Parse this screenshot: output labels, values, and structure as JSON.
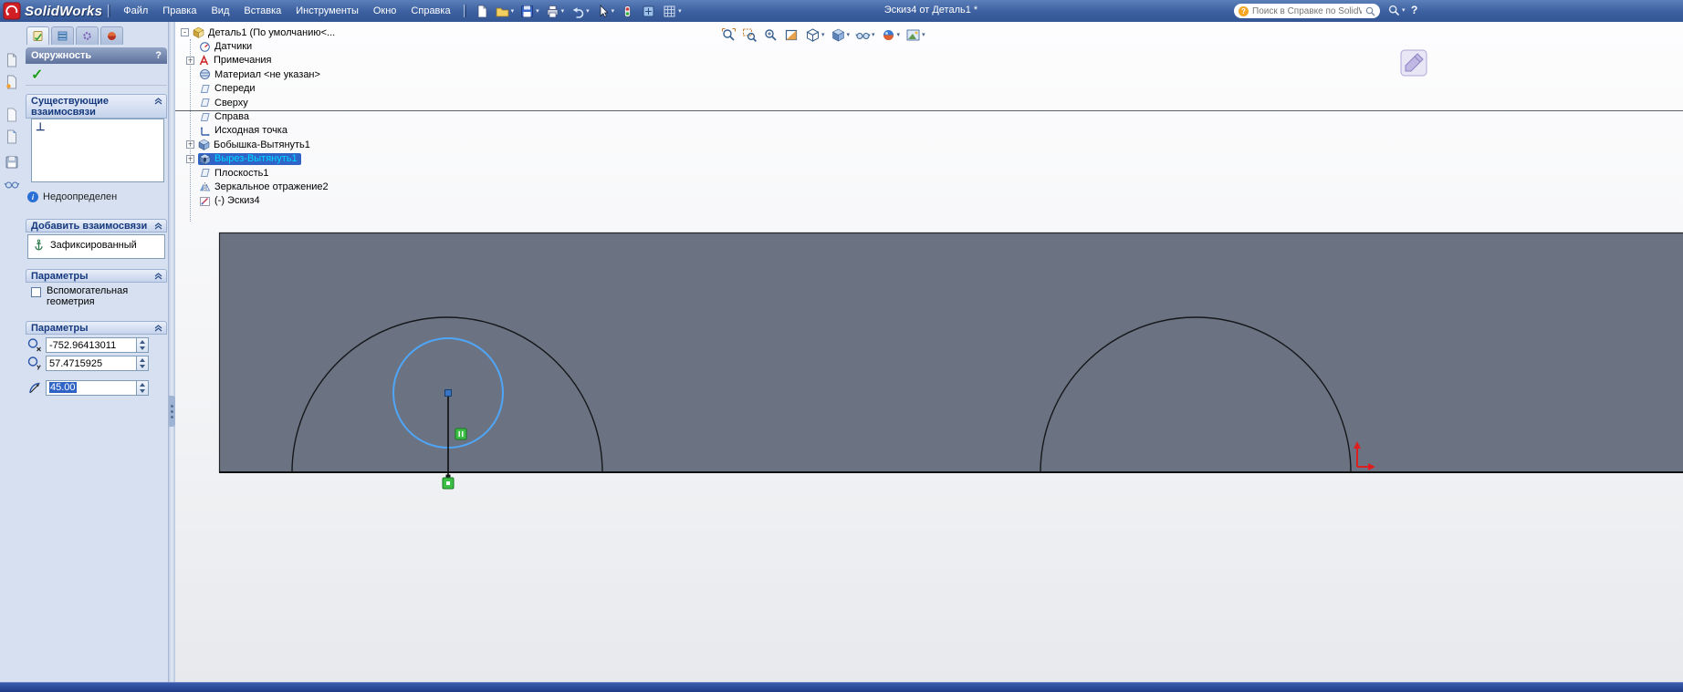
{
  "window": {
    "brand": "SolidWorks",
    "title": "Эскиз4 от Деталь1 *"
  },
  "menu": {
    "items": [
      "Файл",
      "Правка",
      "Вид",
      "Вставка",
      "Инструменты",
      "Окно",
      "Справка"
    ]
  },
  "search": {
    "placeholder": "Поиск в Справке по SolidWorks"
  },
  "property_manager": {
    "title": "Окружность",
    "help_label": "?",
    "existing_relations_title": "Существующие взаимосвязи",
    "status_label": "Недоопределен",
    "add_relations_title": "Добавить взаимосвязи",
    "fixed_button_label": "Зафиксированный",
    "options_title": "Параметры",
    "construction_checkbox_label": "Вспомогательная геометрия",
    "parameters_title": "Параметры",
    "x_value": "-752.96413011",
    "y_value": "57.4715925",
    "radius_value": "45.00"
  },
  "feature_tree": {
    "root_label": "Деталь1 (По умолчанию<...",
    "items": [
      {
        "label": "Датчики"
      },
      {
        "label": "Примечания"
      },
      {
        "label": "Материал <не указан>"
      },
      {
        "label": "Спереди"
      },
      {
        "label": "Сверху"
      },
      {
        "label": "Справа"
      },
      {
        "label": "Исходная точка"
      },
      {
        "label": "Бобышка-Вытянуть1"
      },
      {
        "label": "Вырез-Вытянуть1"
      },
      {
        "label": "Плоскость1"
      },
      {
        "label": "Зеркальное отражение2"
      },
      {
        "label": "(-) Эскиз4"
      }
    ]
  },
  "glyphs": {
    "check": "✓",
    "plus": "+",
    "minus": "-",
    "dropdown": "▾",
    "perpendicular": "⊥",
    "info": "i",
    "question": "?"
  },
  "colors": {
    "selection_blue": "#2f64c6",
    "tree_selected_text": "#00d9ff",
    "sketch_blue": "#4fa6f8",
    "relation_green": "#3dbe46",
    "origin_red": "#de1f1f",
    "part_gray": "#6b7382"
  }
}
